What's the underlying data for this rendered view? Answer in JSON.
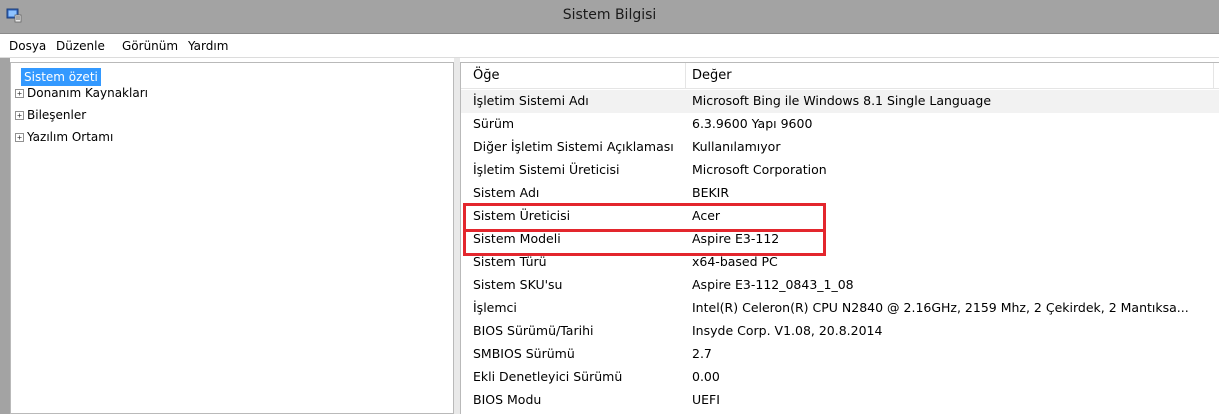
{
  "window": {
    "title": "Sistem Bilgisi"
  },
  "menu": [
    "Dosya",
    "Düzenle",
    "Görünüm",
    "Yardım"
  ],
  "tree": {
    "root": "Sistem özeti",
    "children": [
      "Donanım Kaynakları",
      "Bileşenler",
      "Yazılım Ortamı"
    ]
  },
  "list": {
    "columns": [
      "Öğe",
      "Değer"
    ],
    "rows": [
      [
        "İşletim Sistemi Adı",
        "Microsoft Bing ile Windows 8.1 Single Language"
      ],
      [
        "Sürüm",
        "6.3.9600 Yapı 9600"
      ],
      [
        "Diğer İşletim Sistemi Açıklaması",
        "Kullanılamıyor"
      ],
      [
        "İşletim Sistemi Üreticisi",
        "Microsoft Corporation"
      ],
      [
        "Sistem Adı",
        "BEKIR"
      ],
      [
        "Sistem Üreticisi",
        "Acer"
      ],
      [
        "Sistem Modeli",
        "Aspire E3-112"
      ],
      [
        "Sistem Türü",
        "x64-based PC"
      ],
      [
        "Sistem SKU'su",
        "Aspire E3-112_0843_1_08"
      ],
      [
        "İşlemci",
        "Intel(R) Celeron(R) CPU  N2840  @ 2.16GHz, 2159 Mhz, 2 Çekirdek, 2 Mantıksa..."
      ],
      [
        "BIOS Sürümü/Tarihi",
        "Insyde Corp. V1.08, 20.8.2014"
      ],
      [
        "SMBIOS Sürümü",
        "2.7"
      ],
      [
        "Ekli Denetleyici Sürümü",
        "0.00"
      ],
      [
        "BIOS Modu",
        "UEFI"
      ]
    ]
  },
  "annotations": {
    "highlight_color": "#e3262d",
    "highlighted_rows": [
      "Sistem Üreticisi",
      "Sistem Modeli"
    ]
  },
  "colors": {
    "titlebar": "#a3a3a3",
    "selection": "#3399ff"
  }
}
